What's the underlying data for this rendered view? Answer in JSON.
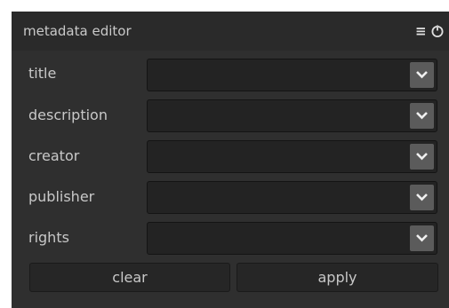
{
  "panel": {
    "title": "metadata editor",
    "menu_icon": "≡"
  },
  "fields": [
    {
      "label": "title",
      "value": ""
    },
    {
      "label": "description",
      "value": ""
    },
    {
      "label": "creator",
      "value": ""
    },
    {
      "label": "publisher",
      "value": ""
    },
    {
      "label": "rights",
      "value": ""
    }
  ],
  "buttons": {
    "clear": "clear",
    "apply": "apply"
  },
  "icons": {
    "menu": "hamburger-menu-icon",
    "reset": "reset-power-icon",
    "dropdown": "chevron-down-icon"
  },
  "colors": {
    "panel_bg": "#2f2f2f",
    "field_bg": "#232323",
    "dropdown_btn": "#5b5b5b",
    "text": "#c8c8c8"
  }
}
